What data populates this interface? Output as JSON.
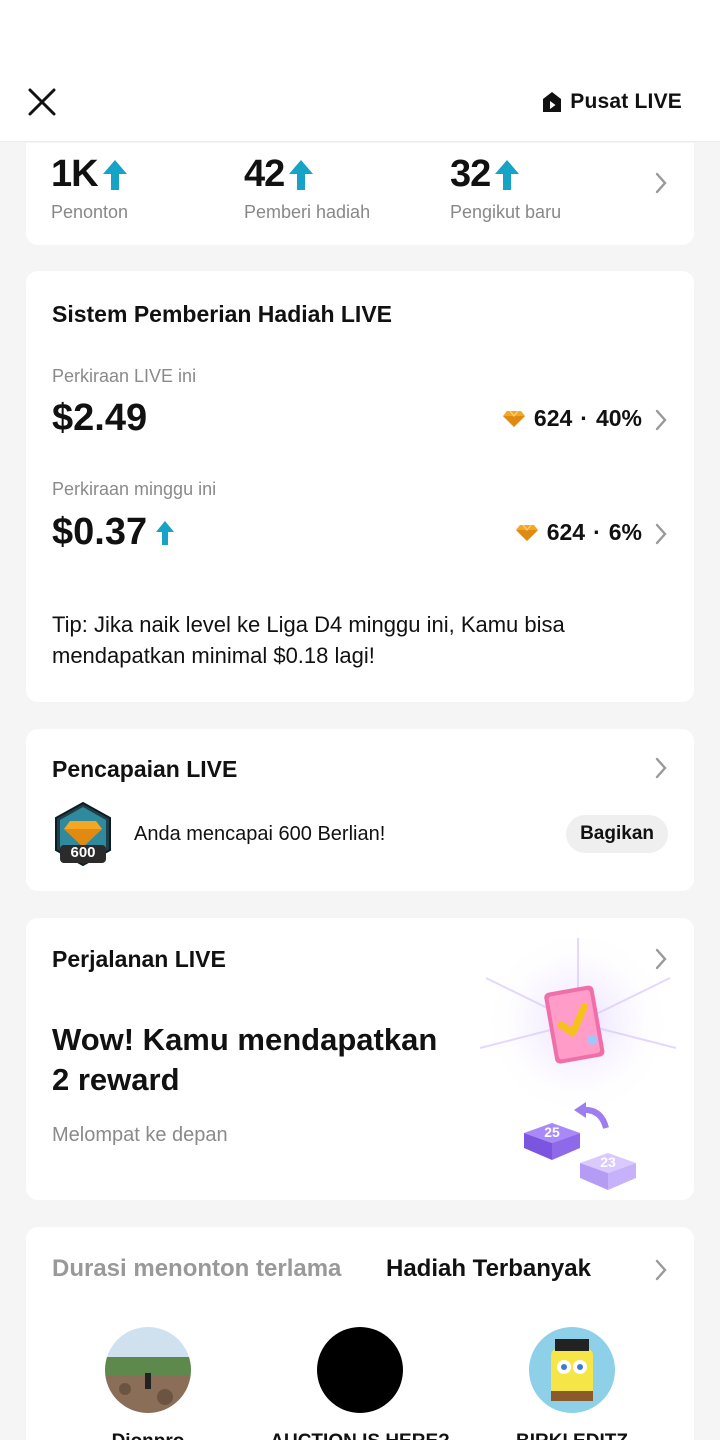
{
  "header": {
    "pusat_label": "Pusat LIVE"
  },
  "stats": [
    {
      "value": "1K",
      "label": "Penonton"
    },
    {
      "value": "42",
      "label": "Pemberi hadiah"
    },
    {
      "value": "32",
      "label": "Pengikut baru"
    }
  ],
  "gift_system": {
    "title": "Sistem Pemberian Hadiah LIVE",
    "live_label": "Perkiraan LIVE ini",
    "live_amount": "$2.49",
    "live_diamonds": "624",
    "live_percent": "40%",
    "week_label": "Perkiraan minggu ini",
    "week_amount": "$0.37",
    "week_diamonds": "624",
    "week_percent": "6%",
    "separator": "·",
    "tip": "Tip: Jika naik level ke Liga D4 minggu ini, Kamu bisa mendapatkan minimal $0.18 lagi!"
  },
  "achievement": {
    "title": "Pencapaian LIVE",
    "badge_number": "600",
    "text": "Anda mencapai 600 Berlian!",
    "share_label": "Bagikan"
  },
  "journey": {
    "title": "Perjalanan LIVE",
    "headline": "Wow! Kamu mendapatkan 2 reward",
    "subtitle": "Melompat ke depan",
    "tile_a": "25",
    "tile_b": "23"
  },
  "leaders": {
    "tab_duration": "Durasi menonton terlama",
    "tab_gifts": "Hadiah Terbanyak",
    "users": [
      {
        "name": "Dionpro"
      },
      {
        "name": "AUCTION IS HERE?"
      },
      {
        "name": "BIRKI EDITZ"
      }
    ]
  },
  "colors": {
    "up_arrow": "#16a3c6",
    "diamond": "#f5a623"
  }
}
